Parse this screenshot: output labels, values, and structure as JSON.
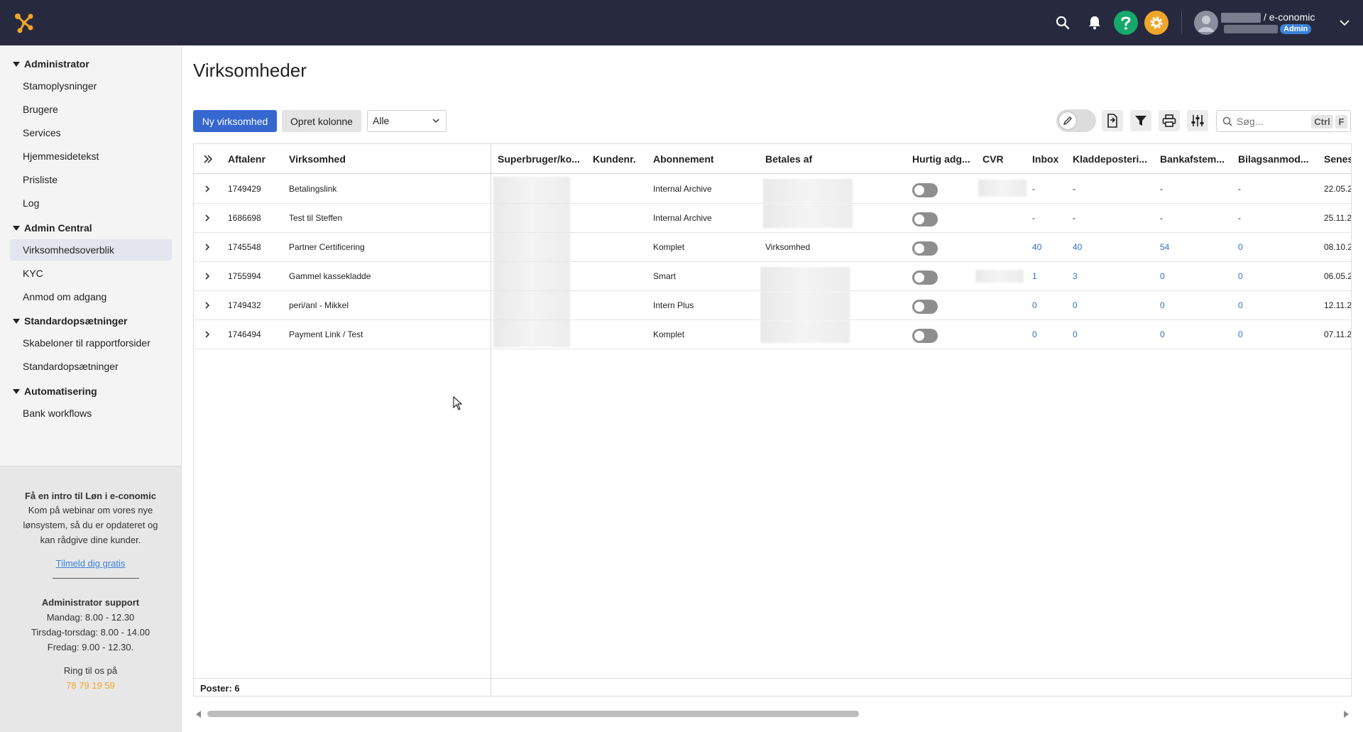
{
  "app": {
    "company": "/ e-conomic",
    "role": "Admin"
  },
  "colors": {
    "topbar": "#272a3e",
    "accent": "#3567cf",
    "help": "#17a86b",
    "settings": "#f0a52b",
    "link": "#2f6fcf"
  },
  "icons": {
    "logo": "e-conomic-logo-icon",
    "search": "search-icon",
    "bell": "bell-icon",
    "help": "help-icon",
    "gear": "gear-icon",
    "avatar": "avatar-icon",
    "chevron": "chevron-down-icon"
  },
  "sidebar": {
    "sections": [
      {
        "label": "Administrator",
        "items": [
          "Stamoplysninger",
          "Brugere",
          "Services",
          "Hjemmesidetekst",
          "Prisliste",
          "Log"
        ]
      },
      {
        "label": "Admin Central",
        "items": [
          "Virksomhedsoverblik",
          "KYC",
          "Anmod om adgang"
        ]
      },
      {
        "label": "Standardopsætninger",
        "items": [
          "Skabeloner til rapportforsider",
          "Standardopsætninger"
        ]
      },
      {
        "label": "Automatisering",
        "items": [
          "Bank workflows"
        ]
      }
    ],
    "active_item": "Virksomhedsoverblik",
    "promo": {
      "title": "Få en intro til Løn i e-conomic",
      "line1": "Kom på webinar om vores nye",
      "line2": "lønsystem, så du er opdateret og",
      "line3": "kan rådgive dine kunder.",
      "link": "Tilmeld dig gratis",
      "support_title": "Administrator support",
      "hours1": "Mandag: 8.00 - 12.30",
      "hours2": "Tirsdag-torsdag: 8.00 - 14.00",
      "hours3": "Fredag: 9.00 - 12.30.",
      "call": "Ring til os på",
      "phone": "78 79 19 59"
    }
  },
  "main": {
    "title": "Virksomheder",
    "new_button": "Ny virksomhed",
    "create_column_button": "Opret kolonne",
    "filter_select": "Alle",
    "search_placeholder": "Søg...",
    "kbd_ctrl": "Ctrl",
    "kbd_f": "F",
    "toolbar_icons": [
      "edit-icon",
      "export-icon",
      "filter-icon",
      "print-icon",
      "settings-sliders-icon"
    ]
  },
  "table": {
    "columns": [
      "Aftalenr",
      "Virksomhed",
      "Superbruger/ko...",
      "Kundenr.",
      "Abonnement",
      "Betales af",
      "Hurtig adg...",
      "CVR",
      "Inbox",
      "Kladdeposteri...",
      "Bankafstem...",
      "Bilagsanmod...",
      "Senes"
    ],
    "rows": [
      {
        "aftalenr": "1749429",
        "virksomhed": "Betalingslink",
        "abonnement": "Internal Archive",
        "betales_af": "",
        "inbox": "-",
        "kladde": "-",
        "bank": "-",
        "bilag": "-",
        "senest": "22.05.2"
      },
      {
        "aftalenr": "1686698",
        "virksomhed": "Test til Steffen",
        "abonnement": "Internal Archive",
        "betales_af": "",
        "inbox": "-",
        "kladde": "-",
        "bank": "-",
        "bilag": "-",
        "senest": "25.11.2"
      },
      {
        "aftalenr": "1745548",
        "virksomhed": "Partner Certificering",
        "abonnement": "Komplet",
        "betales_af": "Virksomhed",
        "inbox": "40",
        "kladde": "40",
        "bank": "54",
        "bilag": "0",
        "senest": "08.10.2"
      },
      {
        "aftalenr": "1755994",
        "virksomhed": "Gammel kassekladde",
        "abonnement": "Smart",
        "betales_af": "",
        "inbox": "1",
        "kladde": "3",
        "bank": "0",
        "bilag": "0",
        "senest": "06.05.2"
      },
      {
        "aftalenr": "1749432",
        "virksomhed": "peri/anl - Mikkel",
        "abonnement": "Intern Plus",
        "betales_af": "",
        "inbox": "0",
        "kladde": "0",
        "bank": "0",
        "bilag": "0",
        "senest": "12.11.2"
      },
      {
        "aftalenr": "1746494",
        "virksomhed": "Payment Link / Test",
        "abonnement": "Komplet",
        "betales_af": "",
        "inbox": "0",
        "kladde": "0",
        "bank": "0",
        "bilag": "0",
        "senest": "07.11.2"
      }
    ],
    "footer": "Poster: 6"
  }
}
